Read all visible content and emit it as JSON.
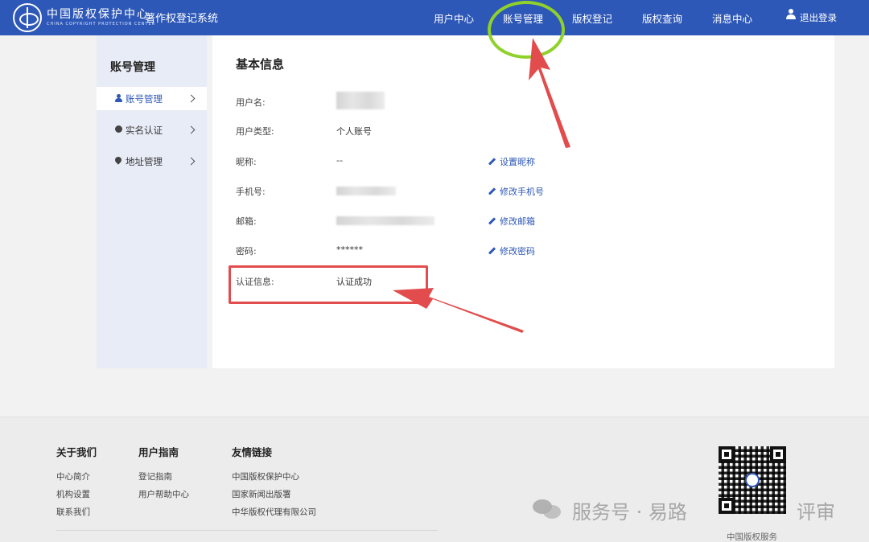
{
  "header": {
    "logo_cn": "中国版权保护中心",
    "logo_en": "CHINA COPYRIGHT PROTECTION CENTER",
    "system_title": "著作权登记系统",
    "nav": [
      "用户中心",
      "账号管理",
      "版权登记",
      "版权查询",
      "消息中心"
    ],
    "logout": "退出登录"
  },
  "sidebar": {
    "title": "账号管理",
    "items": [
      {
        "label": "账号管理",
        "icon": "person-icon",
        "active": true
      },
      {
        "label": "实名认证",
        "icon": "badge-icon",
        "active": false
      },
      {
        "label": "地址管理",
        "icon": "location-pin-icon",
        "active": false
      }
    ]
  },
  "main": {
    "title": "基本信息",
    "rows": [
      {
        "label": "用户名:",
        "value": "",
        "blurred": true
      },
      {
        "label": "用户类型:",
        "value": "个人账号"
      },
      {
        "label": "昵称:",
        "value": "--",
        "action": "设置昵称"
      },
      {
        "label": "手机号:",
        "value": "",
        "blurred": true,
        "action": "修改手机号"
      },
      {
        "label": "邮箱:",
        "value": "",
        "blurred": true,
        "action": "修改邮箱"
      },
      {
        "label": "密码:",
        "value": "******",
        "action": "修改密码"
      },
      {
        "label": "认证信息:",
        "value": "认证成功"
      }
    ]
  },
  "footer": {
    "columns": [
      {
        "heading": "关于我们",
        "links": [
          "中心简介",
          "机构设置",
          "联系我们"
        ]
      },
      {
        "heading": "用户指南",
        "links": [
          "登记指南",
          "用户帮助中心"
        ]
      },
      {
        "heading": "友情链接",
        "links": [
          "中国版权保护中心",
          "国家新闻出版署",
          "中华版权代理有限公司"
        ]
      }
    ],
    "qr_caption": "中国版权服务",
    "watermark": "服务号 · 易路",
    "watermark_tail": "评审"
  },
  "colors": {
    "brand_blue": "#2e58b7",
    "annotation_red": "#e24c4c",
    "annotation_green": "#8fd12a"
  }
}
